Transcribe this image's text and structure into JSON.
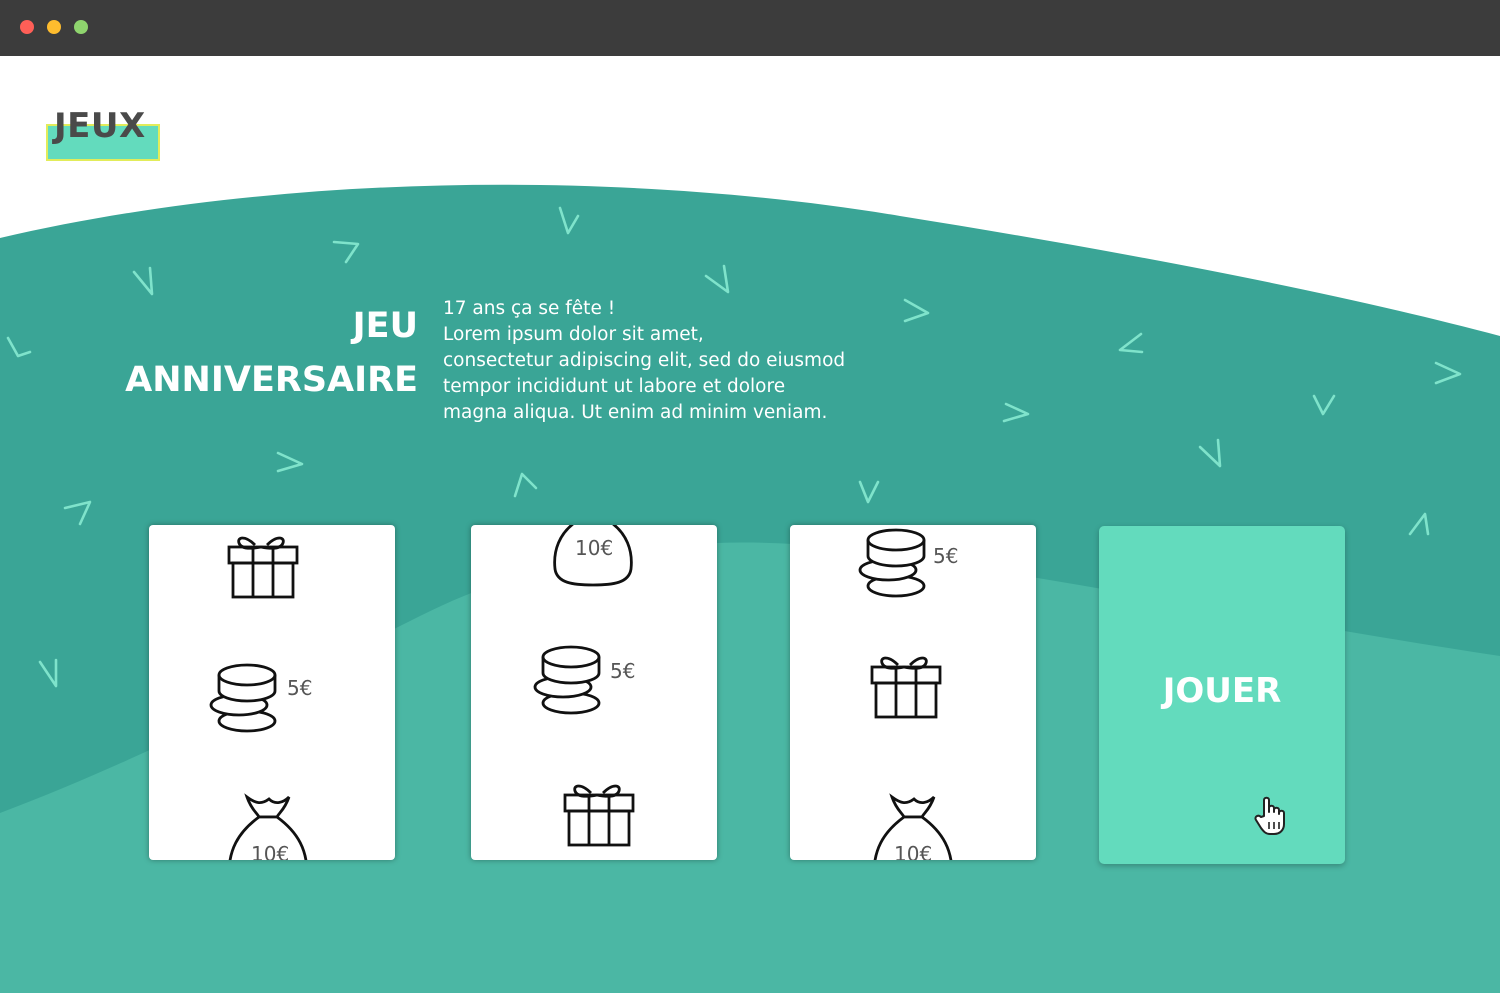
{
  "window": {
    "controls": [
      "close",
      "minimize",
      "maximize"
    ]
  },
  "header": {
    "logo": "JEUX"
  },
  "hero": {
    "title_line1": "JEU",
    "title_line2": "ANNIVERSAIRE",
    "text_lines": [
      "17 ans ça se fête !",
      "Lorem ipsum dolor sit amet,",
      "consectetur adipiscing elit, sed do eiusmod",
      "tempor incididunt ut labore et dolore",
      "magna aliqua. Ut enim ad minim veniam."
    ]
  },
  "reels": [
    {
      "symbols": [
        "gift-icon",
        "coins-icon",
        "money-bag-icon"
      ],
      "coins_label": "5€",
      "bag_label": "10€"
    },
    {
      "symbols": [
        "money-bag-icon",
        "coins-icon",
        "gift-icon"
      ],
      "coins_label": "5€",
      "bag_label": "10€"
    },
    {
      "symbols": [
        "coins-icon",
        "gift-icon",
        "money-bag-icon"
      ],
      "coins_label": "5€",
      "bag_label": "10€"
    }
  ],
  "play_button": {
    "label": "JOUER"
  },
  "colors": {
    "teal_dark": "#3aa596",
    "teal_mid": "#48b3a0",
    "mint": "#63dbbd",
    "logo_border": "#e2ec5a",
    "chevron": "#7fe3cb"
  }
}
